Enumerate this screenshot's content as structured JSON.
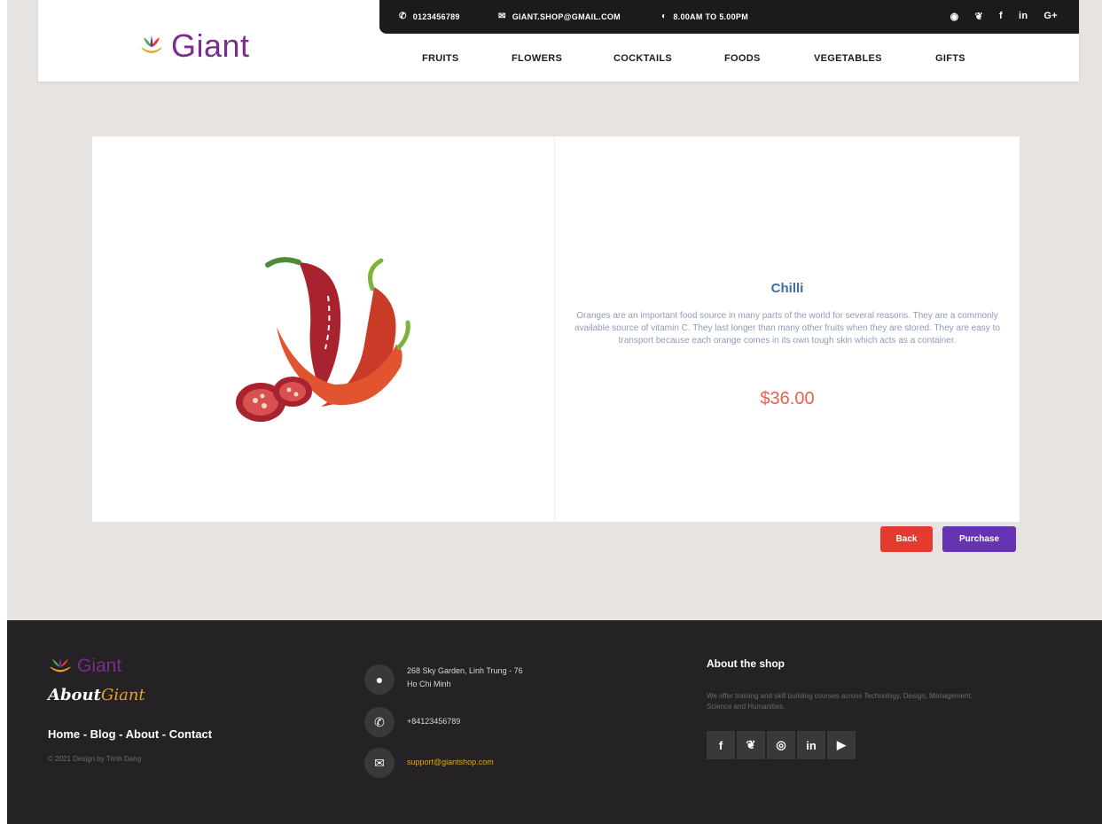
{
  "brand": {
    "name": "Giant"
  },
  "topbar": {
    "phone": "0123456789",
    "email": "GIANT.SHOP@GMAIL.COM",
    "hours": "8.00AM TO 5.00PM",
    "social": [
      "user-icon",
      "twitter-icon",
      "facebook-icon",
      "linkedin-icon",
      "google-plus-icon"
    ]
  },
  "nav": {
    "items": [
      "FRUITS",
      "FLOWERS",
      "COCKTAILS",
      "FOODS",
      "VEGETABLES",
      "GIFTS"
    ]
  },
  "product": {
    "title": "Chilli",
    "description": "Oranges are an important food source in many parts of the world for several reasons. They are a commonly available source of vitamin C. They last longer than many other fruits when they are stored. They are easy to transport because each orange comes in its own tough skin which acts as a container.",
    "price": "$36.00"
  },
  "actions": {
    "back": "Back",
    "purchase": "Purchase"
  },
  "footer": {
    "logo": "Giant",
    "about_prefix": "About",
    "about_brand": "Giant",
    "links": "Home - Blog - About - Contact",
    "copyright": "© 2021 Design by Trinh Dang",
    "address_line1": "268 Sky Garden, Linh Trung - 76",
    "address_line2": "Ho Chi Minh",
    "phone": "+84123456789",
    "email": "support@giantshop.com",
    "shop_title": "About the shop",
    "shop_text": "We offer training and skill building courses across Technology, Design, Management, Science and Humanities.",
    "social": [
      "facebook-icon",
      "twitter-icon",
      "instagram-icon",
      "linkedin-icon",
      "youtube-icon"
    ]
  },
  "colors": {
    "brand": "#7b2d8e",
    "title": "#3b6ea8",
    "price": "#e9604e",
    "back_button": "#e53b2f",
    "purchase_button": "#6634b3",
    "footer_bg": "#242224",
    "accent": "#e3a324"
  }
}
